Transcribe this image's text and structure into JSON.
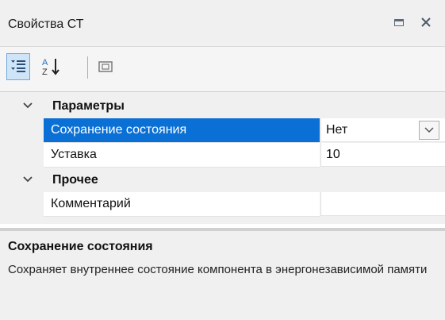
{
  "window": {
    "title": "Свойства СТ"
  },
  "icons": {
    "maximize": "maximize-icon",
    "close": "close-icon",
    "categorized": "categorized-view-icon",
    "alphabetical": "sort-alphabetical-icon",
    "property_pages": "property-pages-icon"
  },
  "toolbar": {
    "alpha_top": "A",
    "alpha_bottom": "Z"
  },
  "grid": {
    "categories": [
      {
        "label": "Параметры",
        "expanded": true,
        "properties": [
          {
            "name": "Сохранение состояния",
            "value": "Нет",
            "selected": true,
            "has_dropdown": true
          },
          {
            "name": "Уставка",
            "value": "10",
            "selected": false,
            "has_dropdown": false
          }
        ]
      },
      {
        "label": "Прочее",
        "expanded": true,
        "properties": [
          {
            "name": "Комментарий",
            "value": "",
            "selected": false,
            "has_dropdown": false
          }
        ]
      }
    ]
  },
  "description": {
    "title": "Сохранение состояния",
    "text": "Сохраняет внутреннее состояние компонента в энергонезависимой памяти"
  },
  "colors": {
    "selection": "#0a70d6",
    "panel_bg": "#f0f0f0",
    "toolbar_active": "#cfe4f7"
  }
}
